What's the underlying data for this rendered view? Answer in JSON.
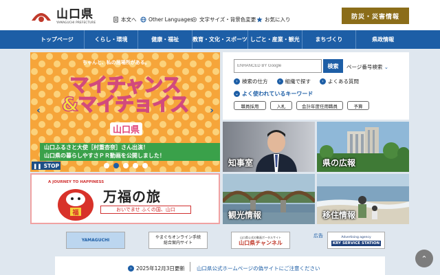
{
  "header": {
    "logo_title": "山口県",
    "logo_sub": "YAMAGUCHI PREFECTURE",
    "util_links": [
      "本文へ",
      "Other Languages",
      "文字サイズ・背景色変更",
      "お気に入り"
    ],
    "disaster_button": "防災・災害情報"
  },
  "nav": {
    "items": [
      "トップページ",
      "くらし・環境",
      "健康・福祉",
      "教育・文化・スポーツ",
      "しごと・産業・観光",
      "まちづくり",
      "県政情報"
    ]
  },
  "slider": {
    "tagline": "ちゃんと、私の居場所がある。",
    "main_text_1": "マイチャンス",
    "main_text_2": "&マイチョイス",
    "city": "山口県",
    "caption_line1": "山口ふるさと大使［村重杏奈］さん出演！",
    "caption_line2": "山口県の暮らしやすさＰＲ動画を公開しました！",
    "stop_label": "STOP",
    "prev_arrow": "‹",
    "next_arrow": "›",
    "dots_count": 5,
    "active_dot": 1
  },
  "banner": {
    "arc_text": "A JOURNEY TO HAPPINESS",
    "title": "万福の旅",
    "sub": "おいでませ ふくの国、山口",
    "daruma_char": "福"
  },
  "search": {
    "placeholder": "ENHANCED BY Google",
    "button": "検索",
    "page_number_search": "ページ番号検索",
    "links": [
      "検索の仕方",
      "組織で探す",
      "よくある質問"
    ],
    "keywords_title": "よく使われているキーワード",
    "keywords": [
      "職員採用",
      "入札",
      "会計年度任用職員",
      "予算"
    ]
  },
  "tiles": [
    {
      "label": "知事室"
    },
    {
      "label": "県の広報"
    },
    {
      "label": "観光情報"
    },
    {
      "label": "移住情報"
    }
  ],
  "ads": {
    "label": "広告",
    "items": [
      {
        "line1": "YAMAGUCHI"
      },
      {
        "line1": "やまぐちオンライン手続",
        "line2": "総合案内サイト"
      },
      {
        "line1": "山口県公式の動画ポータルサイト",
        "line2": "山口県チャンネル"
      },
      {
        "line1": "Advertising agency",
        "line2": "KRY SERVICE STATION"
      }
    ]
  },
  "notice": {
    "date": "2025年12月3日更新",
    "text": "山口県公式ホームページの偽サイトにご注意ください"
  },
  "pagetop": "⌃"
}
